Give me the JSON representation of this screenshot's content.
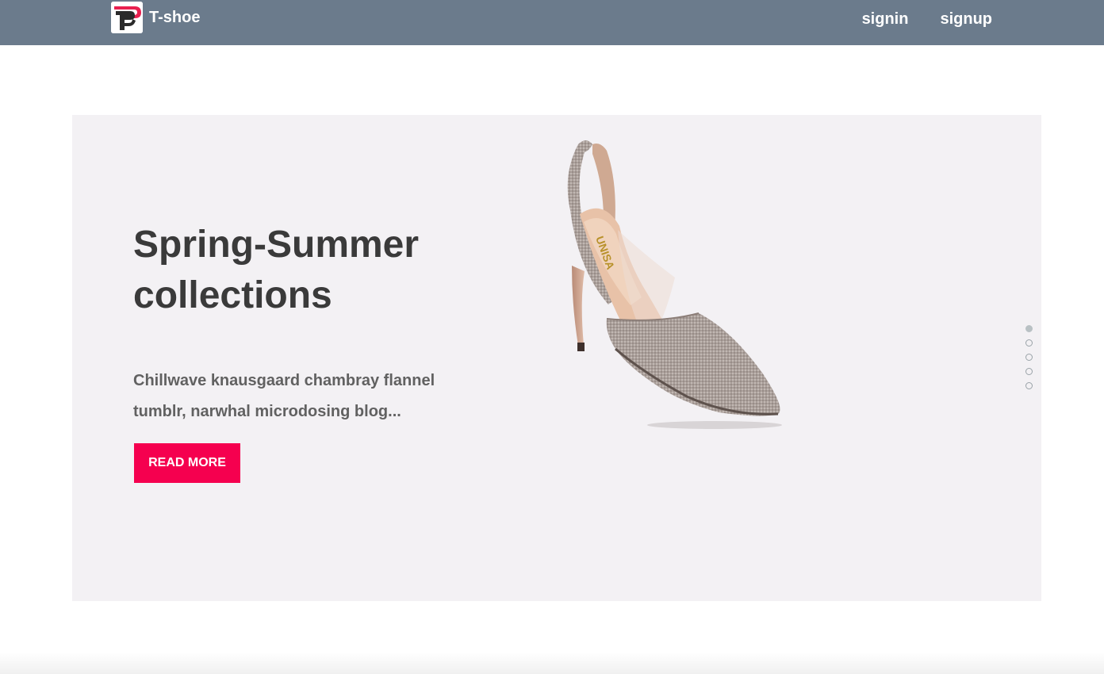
{
  "header": {
    "brand_name": "T-shoe",
    "logo_icon": "tshoe-logo-icon",
    "nav": {
      "signin_label": "signin",
      "signup_label": "signup"
    },
    "background_color": "#6b7b8c"
  },
  "hero": {
    "title": "Spring-Summer collections",
    "description": "Chillwave knausgaard chambray flannel tumblr, narwhal microdosing blog...",
    "button_label": "READ MORE",
    "button_color": "#f5004f",
    "background_color": "#f3f1f4",
    "image_alt": "high-heel-shoe-image",
    "image_text": "UNISA",
    "slider": {
      "slide_count": 5,
      "active_index": 0
    }
  }
}
